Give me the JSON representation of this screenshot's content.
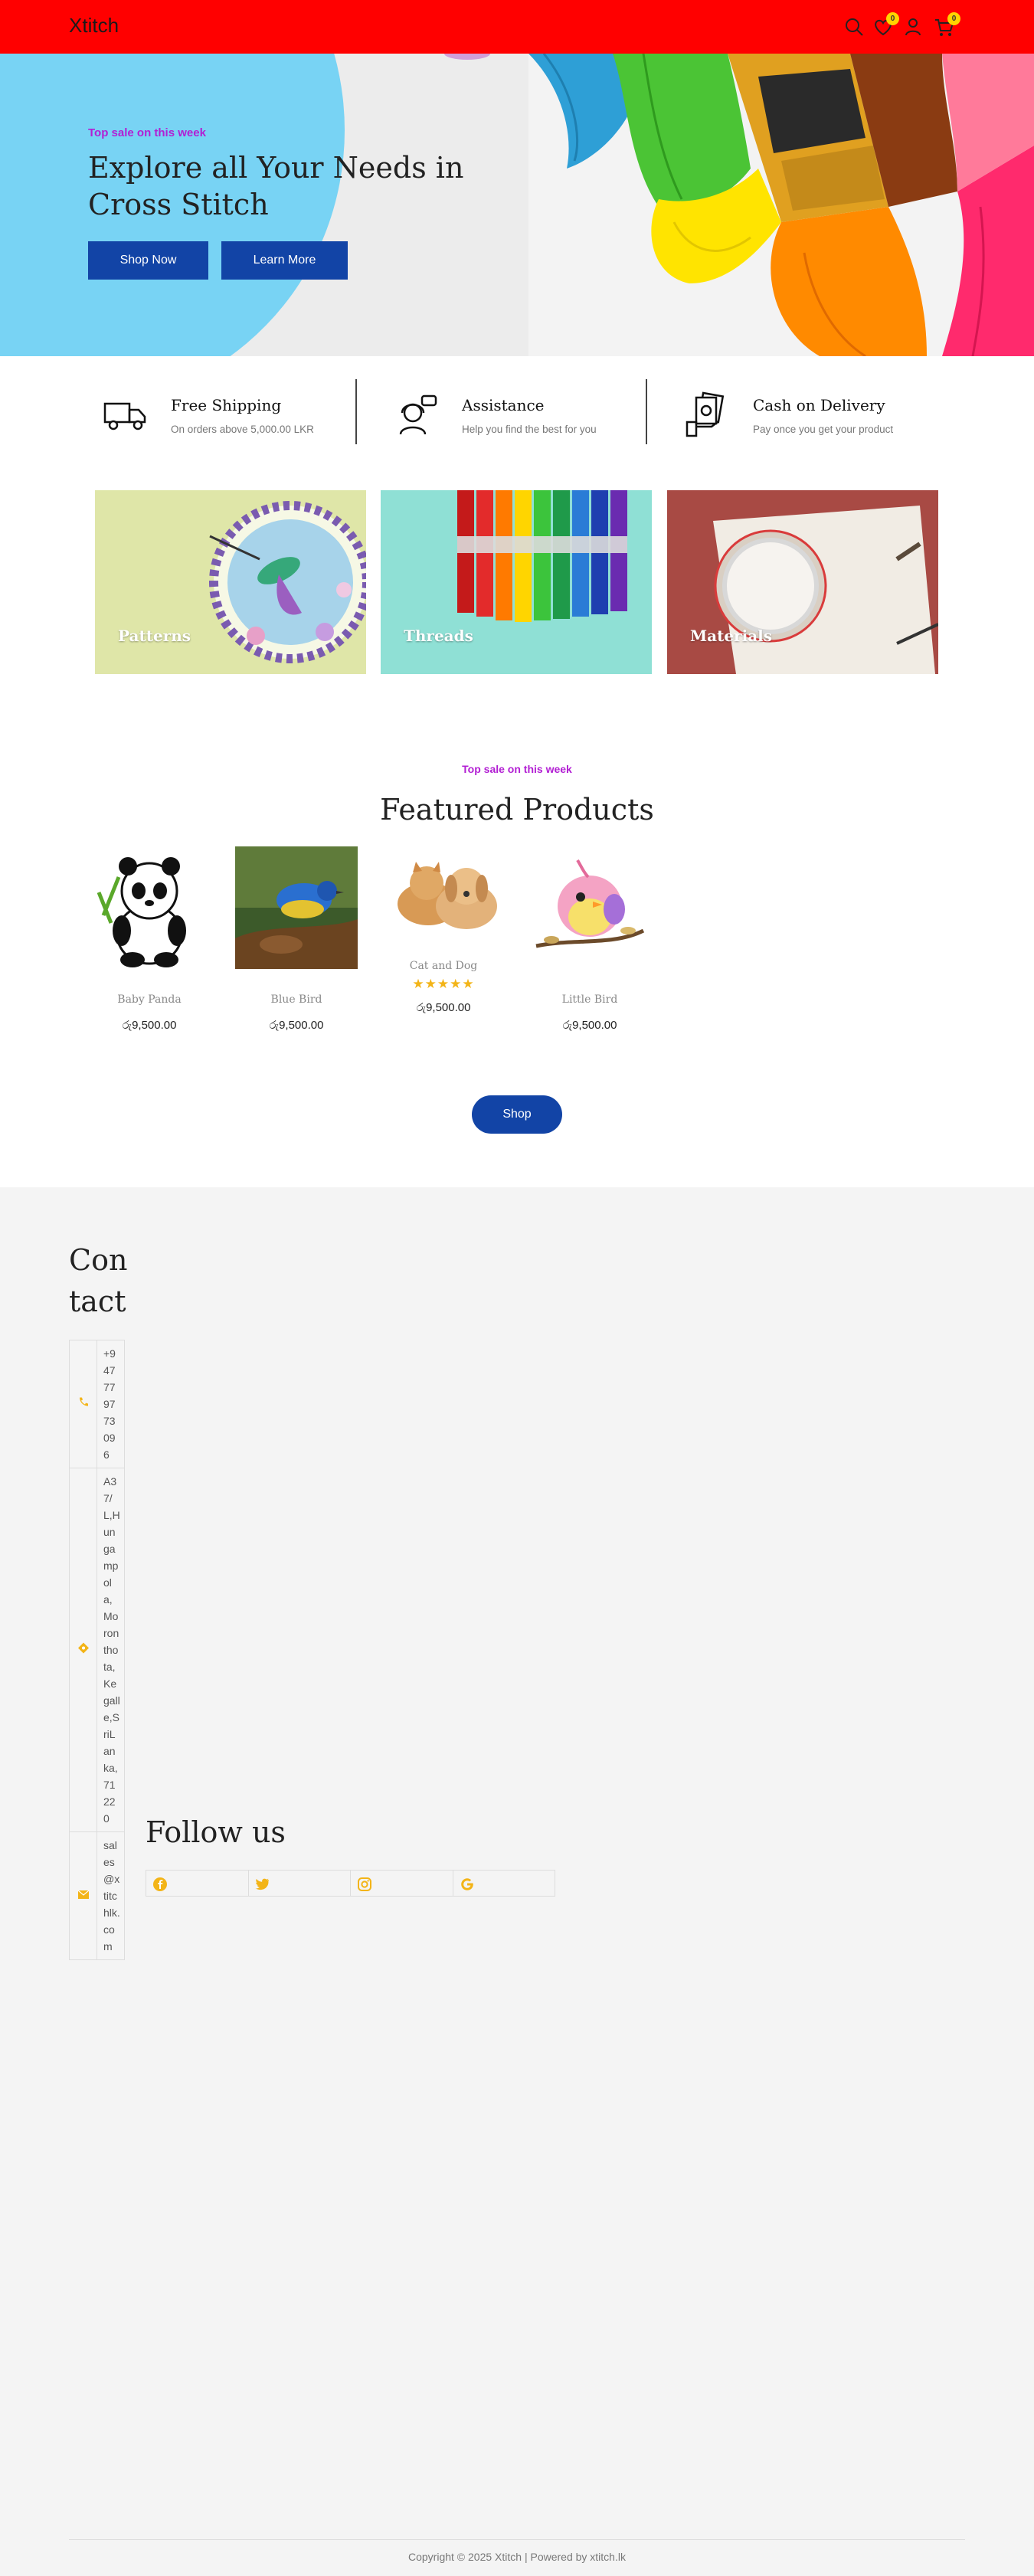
{
  "header": {
    "logo": "Xtitch",
    "wishlist_count": "0",
    "cart_count": "0",
    "icons": [
      "search-icon",
      "heart-icon",
      "user-icon",
      "cart-icon"
    ]
  },
  "hero": {
    "tag": "Top sale on this week",
    "title": "Explore all Your Needs in Cross Stitch",
    "primary_button": "Shop Now",
    "secondary_button": "Learn More"
  },
  "features": [
    {
      "title": "Free Shipping",
      "subtitle": "On orders above 5,000.00 LKR",
      "icon": "delivery-truck-icon"
    },
    {
      "title": "Assistance",
      "subtitle": "Help you find the best for you",
      "icon": "support-agent-icon"
    },
    {
      "title": "Cash on Delivery",
      "subtitle": "Pay once you get your product",
      "icon": "cash-hand-icon"
    }
  ],
  "categories": [
    {
      "label": "Patterns"
    },
    {
      "label": "Threads"
    },
    {
      "label": "Materials"
    }
  ],
  "featured": {
    "tag": "Top sale on this week",
    "title": "Featured Products",
    "products": [
      {
        "name": "Baby Panda",
        "price": "රු9,500.00"
      },
      {
        "name": "Blue Bird",
        "price": "රු9,500.00"
      },
      {
        "name": "Cat and Dog",
        "price": "රු9,500.00",
        "rating": 5
      },
      {
        "name": "Little Bird",
        "price": "රු9,500.00"
      }
    ],
    "shop_button": "Shop"
  },
  "footer": {
    "contact_title": "Contact",
    "phone": "+94777977309 6",
    "address": "A37/L,Hungampola,Moronthota,Kegalle,SriLanka,71220",
    "email": "sales@xtitchlk.com",
    "follow_title": "Follow us",
    "social": [
      "facebook-icon",
      "twitter-icon",
      "instagram-icon",
      "google-icon"
    ],
    "copyright": "Copyright © 2025 Xtitch | Powered by xtitch.lk"
  },
  "colors": {
    "header_bg": "#ff0000",
    "accent_blue": "#1244a6",
    "tag_purple": "#b21fd3",
    "badge_yellow": "#ffd400",
    "footer_bg": "#f4f4f4"
  }
}
